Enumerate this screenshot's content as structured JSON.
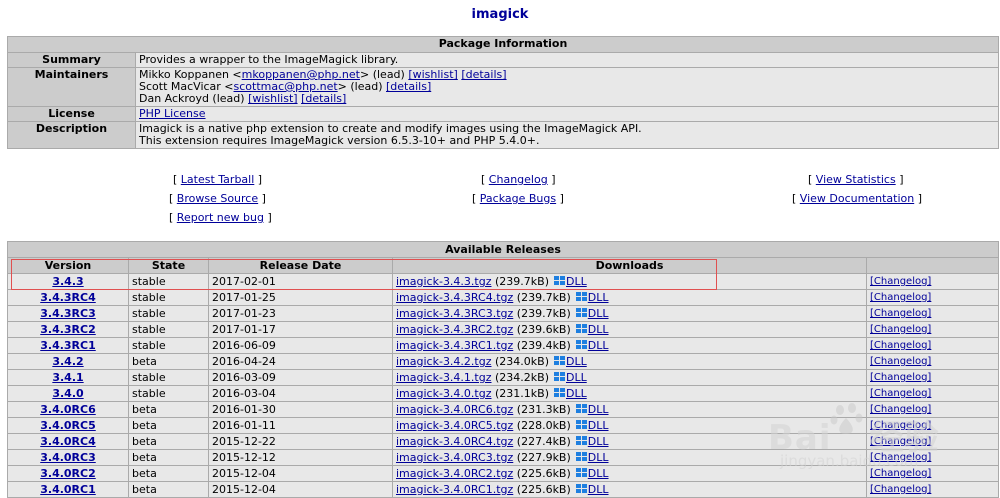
{
  "page": {
    "title": "imagick"
  },
  "package_info": {
    "header": "Package Information",
    "summary_label": "Summary",
    "summary": "Provides a wrapper to the ImageMagick library.",
    "maintainers_label": "Maintainers",
    "maintainers": [
      {
        "name_pre": "Mikko Koppanen <",
        "email": "mkoppanen@php.net",
        "name_post": "> (lead)",
        "wishlist": "[wishlist]",
        "details": "[details]"
      },
      {
        "name_pre": "Scott MacVicar <",
        "email": "scottmac@php.net",
        "name_post": "> (lead)",
        "wishlist": "",
        "details": "[details]"
      },
      {
        "name_pre": "Dan Ackroyd (lead)",
        "email": "",
        "name_post": "",
        "wishlist": "[wishlist]",
        "details": "[details]"
      }
    ],
    "license_label": "License",
    "license": "PHP License",
    "description_label": "Description",
    "description_line1": "Imagick is a native php extension to create and modify images using the ImageMagick API.",
    "description_line2": "This extension requires ImageMagick version 6.5.3-10+ and PHP 5.4.0+."
  },
  "links": {
    "latest_tarball": "Latest Tarball",
    "browse_source": "Browse Source",
    "report_bug": "Report new bug",
    "changelog": "Changelog",
    "package_bugs": "Package Bugs",
    "view_statistics": "View Statistics",
    "view_documentation": "View Documentation",
    "open_bracket": "[",
    "close_bracket": "]"
  },
  "releases": {
    "header": "Available Releases",
    "columns": [
      "Version",
      "State",
      "Release Date",
      "Downloads",
      ""
    ],
    "dll_label": "DLL",
    "changelog_label": "[Changelog]",
    "rows": [
      {
        "version": "3.4.3",
        "state": "stable",
        "date": "2017-02-01",
        "file": "imagick-3.4.3.tgz",
        "size": "(239.7kB)"
      },
      {
        "version": "3.4.3RC4",
        "state": "stable",
        "date": "2017-01-25",
        "file": "imagick-3.4.3RC4.tgz",
        "size": "(239.7kB)"
      },
      {
        "version": "3.4.3RC3",
        "state": "stable",
        "date": "2017-01-23",
        "file": "imagick-3.4.3RC3.tgz",
        "size": "(239.7kB)"
      },
      {
        "version": "3.4.3RC2",
        "state": "stable",
        "date": "2017-01-17",
        "file": "imagick-3.4.3RC2.tgz",
        "size": "(239.6kB)"
      },
      {
        "version": "3.4.3RC1",
        "state": "stable",
        "date": "2016-06-09",
        "file": "imagick-3.4.3RC1.tgz",
        "size": "(239.4kB)"
      },
      {
        "version": "3.4.2",
        "state": "beta",
        "date": "2016-04-24",
        "file": "imagick-3.4.2.tgz",
        "size": "(234.0kB)"
      },
      {
        "version": "3.4.1",
        "state": "stable",
        "date": "2016-03-09",
        "file": "imagick-3.4.1.tgz",
        "size": "(234.2kB)"
      },
      {
        "version": "3.4.0",
        "state": "stable",
        "date": "2016-03-04",
        "file": "imagick-3.4.0.tgz",
        "size": "(231.1kB)"
      },
      {
        "version": "3.4.0RC6",
        "state": "beta",
        "date": "2016-01-30",
        "file": "imagick-3.4.0RC6.tgz",
        "size": "(231.3kB)"
      },
      {
        "version": "3.4.0RC5",
        "state": "beta",
        "date": "2016-01-11",
        "file": "imagick-3.4.0RC5.tgz",
        "size": "(228.0kB)"
      },
      {
        "version": "3.4.0RC4",
        "state": "beta",
        "date": "2015-12-22",
        "file": "imagick-3.4.0RC4.tgz",
        "size": "(227.4kB)"
      },
      {
        "version": "3.4.0RC3",
        "state": "beta",
        "date": "2015-12-12",
        "file": "imagick-3.4.0RC3.tgz",
        "size": "(227.9kB)"
      },
      {
        "version": "3.4.0RC2",
        "state": "beta",
        "date": "2015-12-04",
        "file": "imagick-3.4.0RC2.tgz",
        "size": "(225.6kB)"
      },
      {
        "version": "3.4.0RC1",
        "state": "beta",
        "date": "2015-12-04",
        "file": "imagick-3.4.0RC1.tgz",
        "size": "(225.6kB)"
      }
    ]
  },
  "watermark": {
    "brand": "Bai",
    "brand2": "经验",
    "sub": "jingyan.baidu.com"
  },
  "colors": {
    "link": "#000099",
    "header_bg": "#cccccc",
    "cell_bg": "#e8e8e8",
    "win_icon": "#1e7fe0",
    "highlight": "#e05050"
  }
}
